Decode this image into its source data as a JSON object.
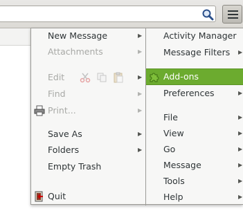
{
  "window": {
    "search_value": ""
  },
  "menu": {
    "left": {
      "new_message": "New Message",
      "attachments": "Attachments",
      "edit": "Edit",
      "find": "Find",
      "print": "Print...",
      "save_as": "Save As",
      "folders": "Folders",
      "empty_trash": "Empty Trash",
      "quit": "Quit"
    },
    "right": {
      "activity_manager": "Activity Manager",
      "message_filters": "Message Filters",
      "addons": "Add-ons",
      "preferences": "Preferences",
      "file": "File",
      "view": "View",
      "go": "Go",
      "message": "Message",
      "tools": "Tools",
      "help": "Help"
    },
    "submenu_arrow": "▶"
  },
  "colors": {
    "highlight": "#6cab2f",
    "disabled_text": "#a8a9a6"
  },
  "icons": {
    "search": "magnifier-icon",
    "app_menu": "hamburger-icon",
    "cut": "scissors-icon",
    "copy": "copy-icon",
    "paste": "clipboard-icon",
    "print": "printer-icon",
    "addons": "puzzle-piece-icon",
    "quit": "exit-door-icon"
  }
}
